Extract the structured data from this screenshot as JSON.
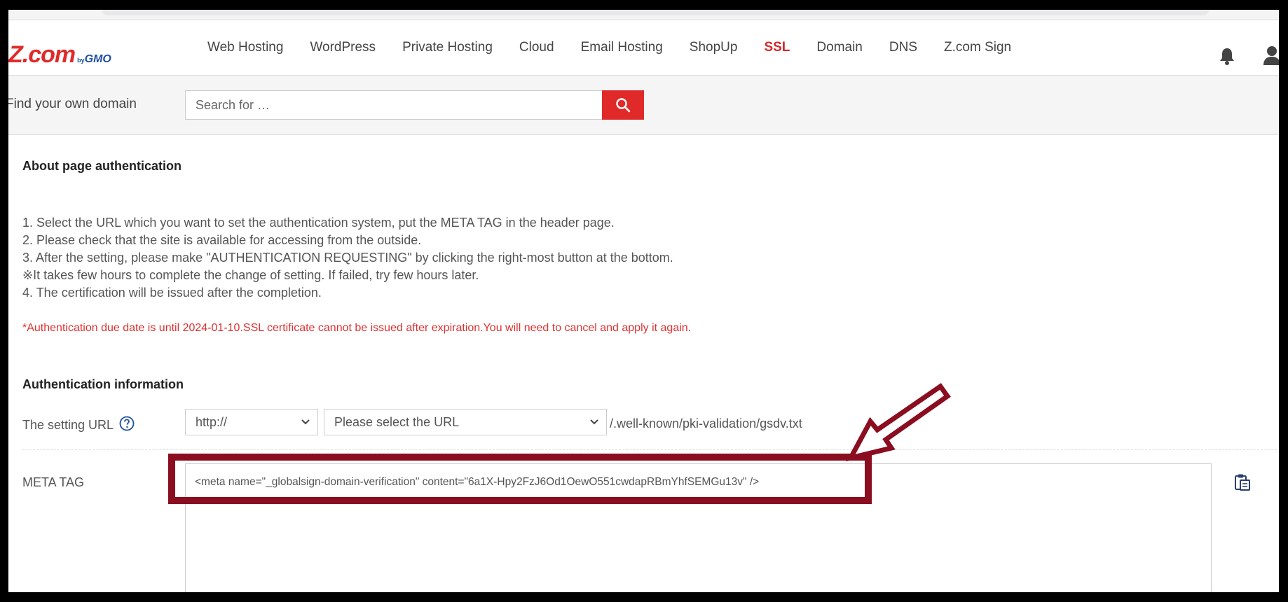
{
  "header": {
    "logo": {
      "main": "Z.com",
      "by": "by",
      "gmo": "GMO"
    },
    "nav": [
      {
        "label": "Web Hosting",
        "active": false
      },
      {
        "label": "WordPress",
        "active": false
      },
      {
        "label": "Private Hosting",
        "active": false
      },
      {
        "label": "Cloud",
        "active": false
      },
      {
        "label": "Email Hosting",
        "active": false
      },
      {
        "label": "ShopUp",
        "active": false
      },
      {
        "label": "SSL",
        "active": true
      },
      {
        "label": "Domain",
        "active": false
      },
      {
        "label": "DNS",
        "active": false
      },
      {
        "label": "Z.com Sign",
        "active": false
      }
    ],
    "icons": {
      "notifications": "bell-icon",
      "account": "user-icon"
    }
  },
  "search": {
    "label": "Find your own domain",
    "placeholder": "Search for …",
    "button_icon": "search-icon"
  },
  "about": {
    "title": "About page authentication",
    "steps": [
      "1. Select the URL which you want to set the authentication system, put the META TAG in the header page.",
      "2. Please check that the site is available for accessing from the outside.",
      "3. After the setting, please make \"AUTHENTICATION REQUESTING\" by clicking the right-most button at the bottom.",
      "※It takes few hours to complete the change of setting. If failed, try few hours later.",
      "4.  The certification will be issued after the completion."
    ],
    "notice": "*Authentication due date is until 2024-01-10.SSL certificate cannot be issued after expiration.You will need to cancel and apply it again."
  },
  "auth_info": {
    "title": "Authentication information",
    "setting_url_label": "The setting URL",
    "protocol_selected": "http://",
    "url_selected": "Please select the URL",
    "url_suffix": "/.well-known/pki-validation/gsdv.txt",
    "meta_tag_label": "META TAG",
    "meta_tag_value": "<meta name=\"_globalsign-domain-verification\" content=\"6a1X-Hpy2FzJ6Od1OewO551cwdapRBmYhfSEMGu13v\" />"
  },
  "colors": {
    "brand_red": "#e02a2a",
    "annotation": "#8a0d20"
  }
}
